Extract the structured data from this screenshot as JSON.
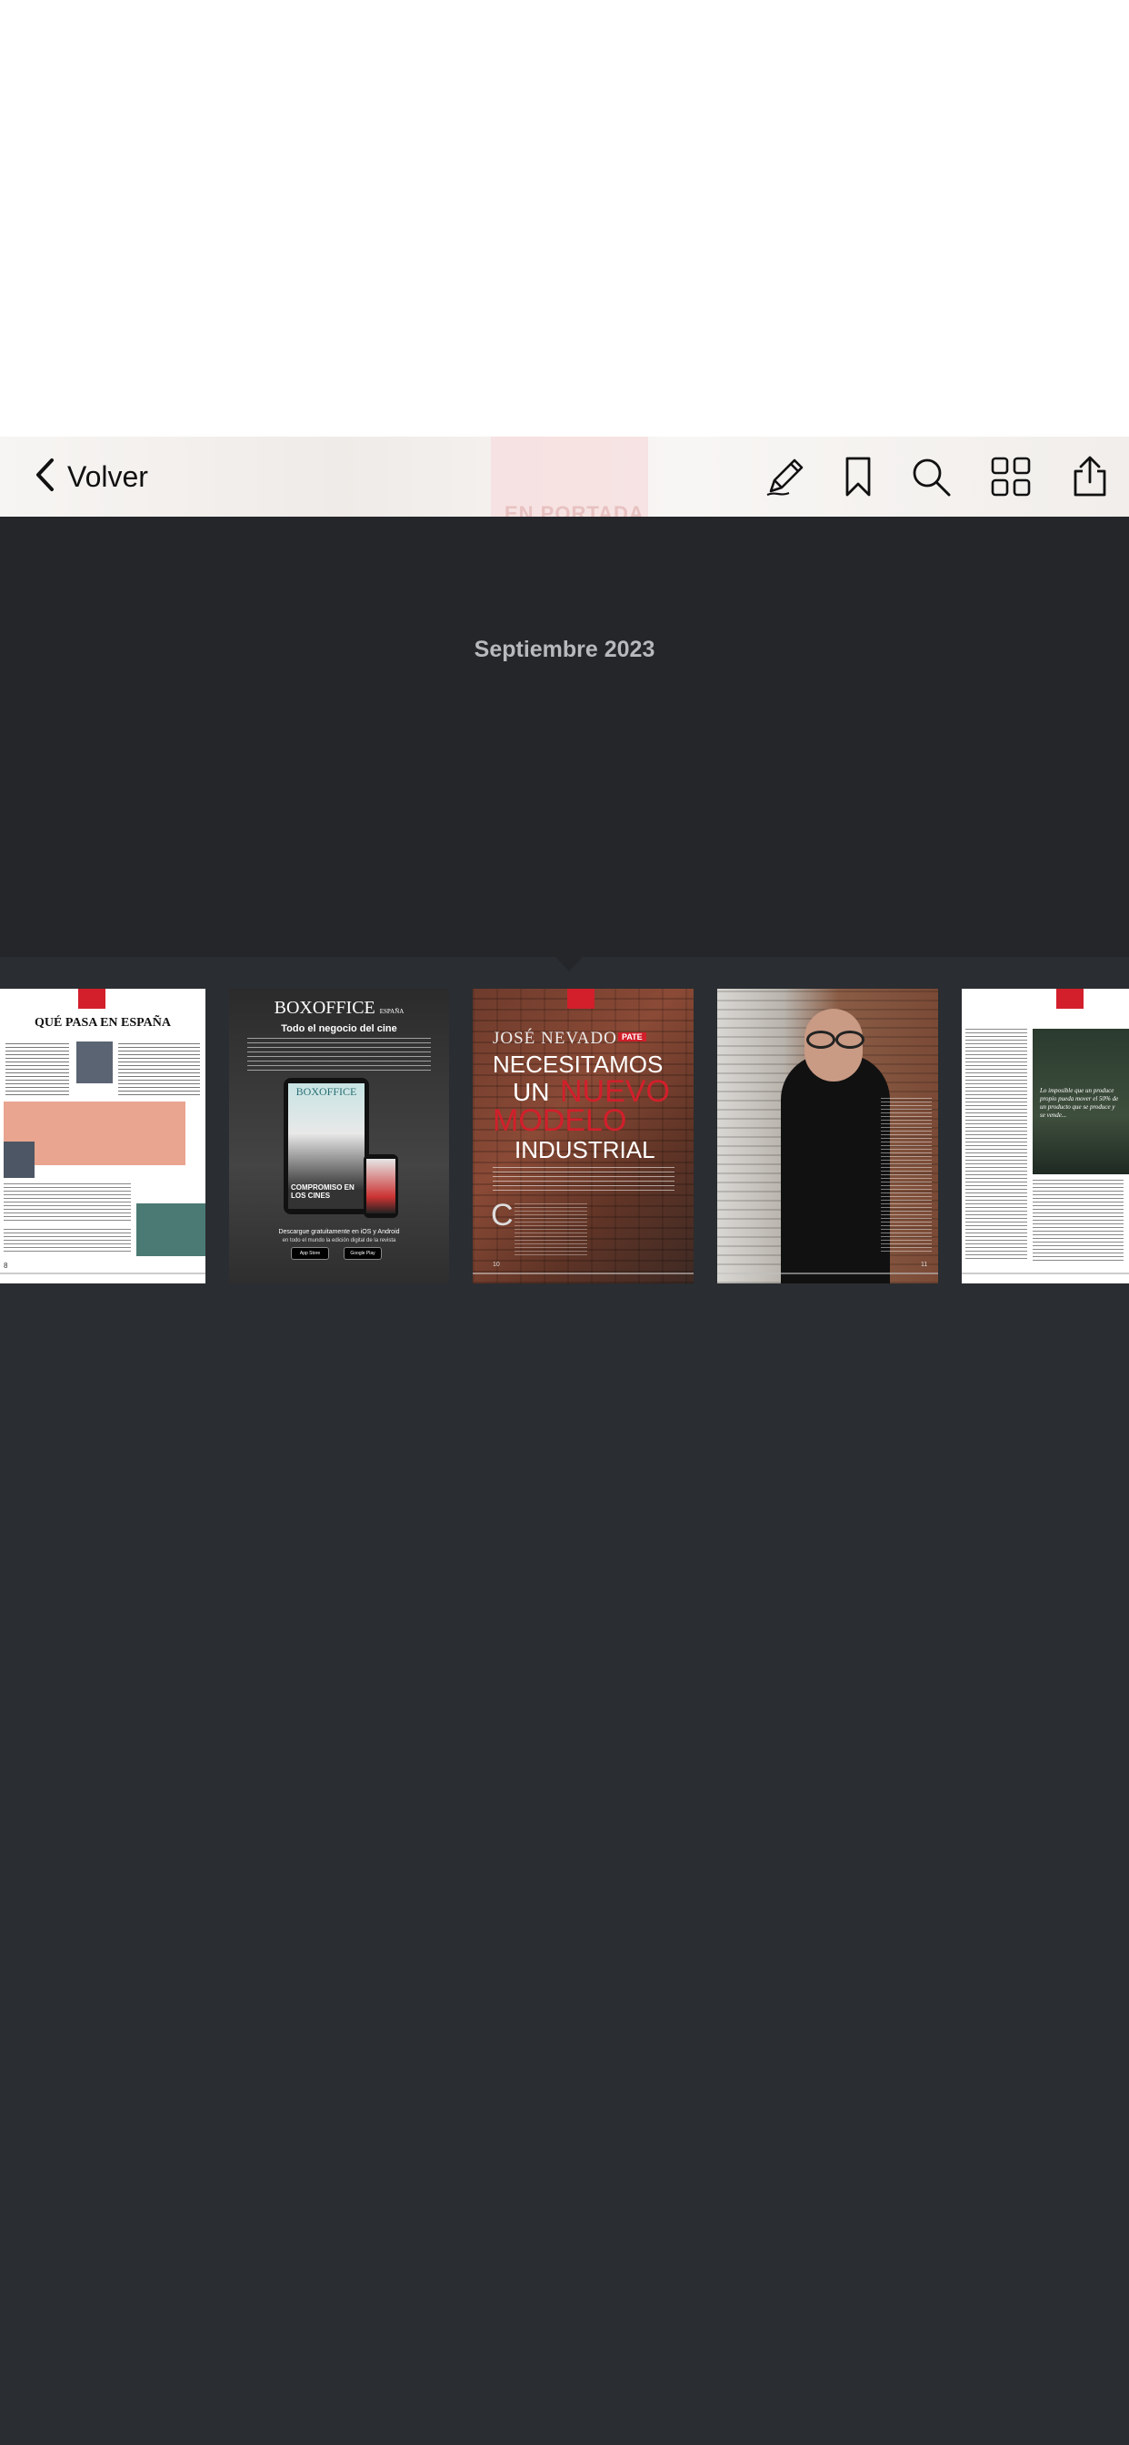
{
  "toolbar": {
    "back_label": "Volver",
    "background_page_text": "EN PORTADA",
    "icons": [
      "annotate-pencil-icon",
      "bookmark-icon",
      "search-icon",
      "grid-view-icon",
      "share-icon"
    ]
  },
  "issue": {
    "date_label": "Septiembre 2023"
  },
  "thumbnails": {
    "page1": {
      "headline": "QUÉ PASA EN ESPAÑA",
      "page_number": "8"
    },
    "page2": {
      "brand": "BOXOFFICE",
      "brand_sub": "ESPAÑA",
      "tagline": "Todo el negocio del cine",
      "cover_text": "COMPROMISO EN LOS CINES",
      "download_text": "Descargue gratuitamente en iOS y Android",
      "download_sub": "en todo el mundo la edición digital de la revista",
      "store_badges": [
        "App Store",
        "Google Play"
      ]
    },
    "page3": {
      "name": "JOSÉ NEVADO",
      "badge": "PATE",
      "headline_white_1": "NECESITAMOS",
      "headline_white_2": "UN",
      "headline_red_1": "NUEVO",
      "headline_red_2": "MODELO",
      "headline_white_3": "INDUSTRIAL",
      "drop_cap": "C",
      "page_number": "10"
    },
    "page4": {
      "page_number": "11"
    },
    "page5": {
      "pull_quote": "Lo imposible que un produce propio pueda mover el 50% de un producto que se produce y se vende..."
    }
  },
  "colors": {
    "accent_red": "#d21f2b",
    "toolbar_bg": "#f4f1ef",
    "dark_bg": "#24262a",
    "strip_bg": "#2a2d31",
    "date_text": "#b7b9bc"
  }
}
